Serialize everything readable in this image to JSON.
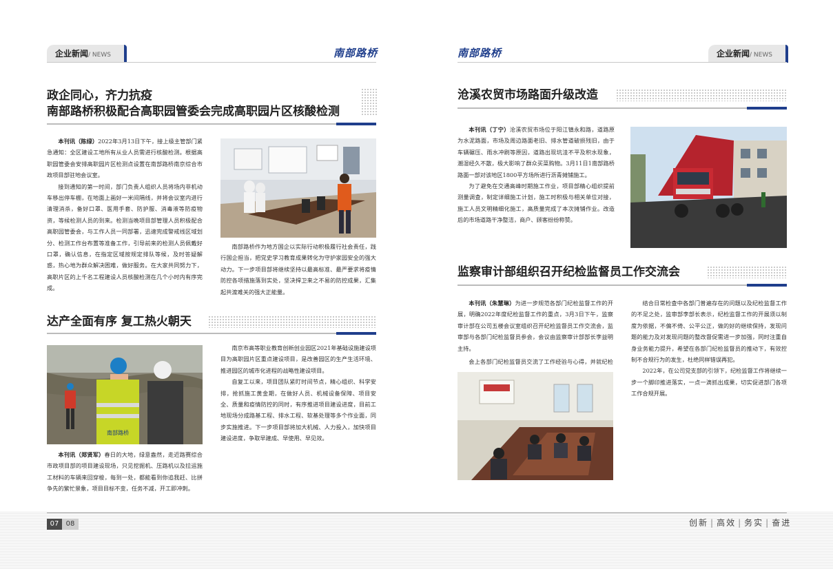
{
  "header": {
    "tab_title": "企业新闻",
    "tab_sub": "/ NEWS",
    "brand": "南部路桥"
  },
  "left": {
    "article1": {
      "title_line1": "政企同心，齐力抗疫",
      "title_line2": "南部路桥积极配合高职园管委会完成高职园片区核酸检测",
      "byline": "本刊讯（陈绿）",
      "p1": "2022年3月13日下午，接上级主管部门紧急通知：全区建设工地所有从业人员需进行核酸检测。根据高职园管委会安排高职园片区检测点设置在南部路桥南京综合市政项目部驻地会议室。",
      "p2": "接到通知的第一时间，部门负责人组织人员将场内非机动车移出停车棚，在地面上画好一米间隔线，并将会议室内进行清理消杀，备好口罩、医用手套、防护服、消毒液等防疫物资，等候检测人员的到来。检测当晚项目部管理人员积极配合高职园管委会，与工作人员一同部署，迅速完成警戒线区域划分、检测工作台布置等准备工作，引导前来的检测人员佩戴好口罩，确认信息，在指定区域按规定排队等候，及时答疑解惑，热心地为群众解决困难，做好服务。在大家共同努力下，高职片区的上千名工程建设人员核酸检测在几个小时内有序完成。",
      "p3": "南部路桥作为地方国企以实际行动积极履行社会责任，践行国企担当，把党史学习教育成果转化为守护家园安全的强大动力。下一步项目部将继续坚持以最高标准、最严要求将疫情防控各项措施落到实处，坚决捍卫来之不易的防控成果，汇集起共渡难关的强大正能量。"
    },
    "article2": {
      "title": "达产全面有序 复工热火朝天",
      "byline": "本刊讯（郑贤军）",
      "p1": "春日的大地，绿意盎然，走近路赛综合市政项目部的项目建设现场，只见挖掘机、压路机以及拉运施工材料的车辆来回穿梭，每到一处，都能看到你追我赶、比拼争先的繁忙景象，项目目标不变，任务不减，开工即冲刺。",
      "p2": "南京市高等职业教育创新创业园区2021年基础设施建设项目为高职园片区重点建设项目，是改善园区的生产生活环境、推进园区的城市化进程的战略性建设项目。",
      "p3": "自复工以来，项目团队紧盯时间节点，精心组织、科学安排，抢抓施工黄金期，在做好人员、机械设备保障、项目安全、质量和疫情防控的同时，有序推进项目建设进度，目前工地现场分成路基工程、排水工程、软基处理等多个作业面，同步实施推进。下一步项目部将加大机械、人力投入，加快项目建设进度，争取早建成、早使用、早见效。",
      "vest_text": "南部路桥"
    }
  },
  "right": {
    "article3": {
      "title": "沧溪农贸市场路面升级改造",
      "byline": "本刊讯（丁宁）",
      "p1": "沧溪农贸市场位于阳江镇永和路，道路原为水泥路面，市场及周边路面老旧、排水管道破损残旧，由于车辆碾压、雨水冲刷等原因，道路出现坑洼不平及积水现象，潮湿经久不散，极大影响了群众买菜购物。3月11日1南部路桥路面一部对该地区1800平方场所进行沥青摊铺施工。",
      "p2": "为了避免在交通高峰时期施工作业，项目部精心组织提前测量调查，制定详细施工计划，施工时积极与相关单位对接，施工人员文明精细化施工，高质量完成了本次摊铺作业。改造后的市场道路干净整洁，商户、顾客纷纷称赞。"
    },
    "article4": {
      "title": "监察审计部组织召开纪检监督员工作交流会",
      "byline": "本刊讯（朱慧琳）",
      "p1": "为进一步规范各部门纪检监督工作的开展，明确2022年度纪检监督工作的重点，3月3日下午，监察审计部在公司五楼会议室组织召开纪检监督员工作交流会，监审部与各部门纪检监督员参会，会议由监察审计部部长李益明主持。",
      "p2": "会上各部门纪检监督员交流了工作经验与心得，并就纪检监督工作中开展的重点、难点进行了现场交流讨论。各纪检监督员一致认为纪检监督工作涵盖面较广，既是对部门工作的监督指导，也促进着个人业务能力的提升，但工作中也存在检查浮于表面、发现的问题不全面或对存在问题整改未落实等现象，特别是对计划采购、分包管理方面监督效果不明显。",
      "p3": "结合日常检查中各部门普遍存在的问题以及纪检监督工作的不足之处，监审部李部长表示，纪检监督工作的开展须以制度为依据，不偏不倚、公平公正，做的好的继续保持，发现问题的能力及对发现问题的整改督促需进一步加强，同时注重自身业务能力提升，希望在各部门纪检监督员的推动下，有效控制不合规行为的发生，杜绝同样错误再犯。",
      "p4": "2022年，在公司党支部的引领下，纪检监督工作将继续一步一个脚印推进落实，一点一滴抓出成果，切实促进部门各项工作合规开展。"
    }
  },
  "footer": {
    "page_left": "07",
    "page_right": "08",
    "slogan": [
      "创新",
      "高效",
      "务实",
      "奋进"
    ]
  },
  "colors": {
    "accent_blue": "#1f3e8c",
    "rule_gray": "#bbbbbb"
  }
}
